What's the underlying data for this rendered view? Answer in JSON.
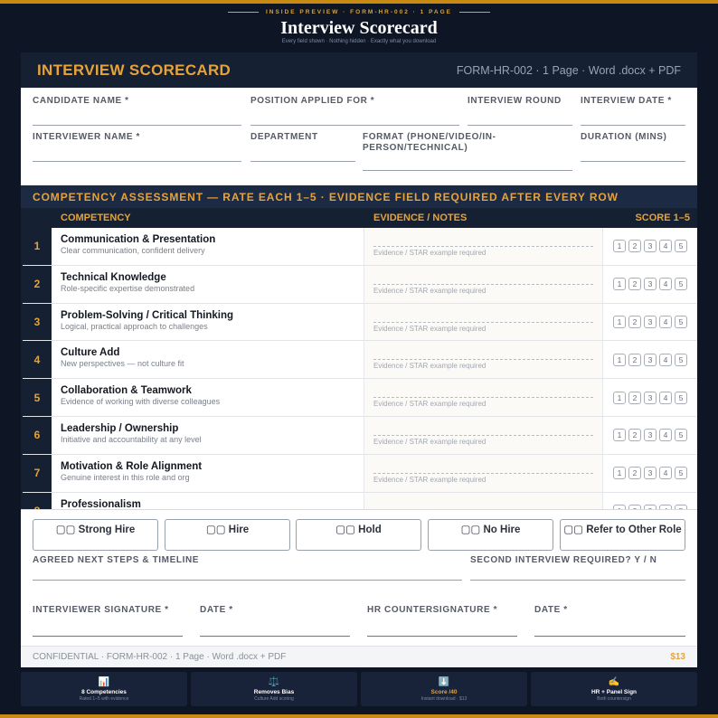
{
  "preview": {
    "kicker": "INSIDE PREVIEW · FORM-HR-002 · 1 PAGE",
    "title": "Interview Scorecard",
    "subtitle": "Every field shown · Nothing hidden · Exactly what you download"
  },
  "doc": {
    "title": "INTERVIEW SCORECARD",
    "meta": "FORM-HR-002 · 1 Page · Word .docx + PDF"
  },
  "fields": {
    "candidate_name": "CANDIDATE NAME *",
    "position": "POSITION APPLIED FOR *",
    "round": "INTERVIEW ROUND",
    "date": "INTERVIEW DATE *",
    "interviewer": "INTERVIEWER NAME *",
    "department": "DEPARTMENT",
    "format": "FORMAT (PHONE/VIDEO/IN-PERSON/TECHNICAL)",
    "duration": "DURATION (MINS)"
  },
  "competency": {
    "band": "COMPETENCY ASSESSMENT — RATE EACH 1–5 · EVIDENCE FIELD REQUIRED AFTER EVERY ROW",
    "headers": {
      "competency": "COMPETENCY",
      "evidence": "EVIDENCE / NOTES",
      "score": "SCORE 1–5"
    },
    "evidence_hint": "Evidence / STAR example required",
    "scores": [
      "1",
      "2",
      "3",
      "4",
      "5"
    ],
    "rows": [
      {
        "num": "1",
        "name": "Communication & Presentation",
        "desc": "Clear communication, confident delivery"
      },
      {
        "num": "2",
        "name": "Technical Knowledge",
        "desc": "Role-specific expertise demonstrated"
      },
      {
        "num": "3",
        "name": "Problem-Solving / Critical Thinking",
        "desc": "Logical, practical approach to challenges"
      },
      {
        "num": "4",
        "name": "Culture Add",
        "desc": "New perspectives — not culture fit"
      },
      {
        "num": "5",
        "name": "Collaboration & Teamwork",
        "desc": "Evidence of working with diverse colleagues"
      },
      {
        "num": "6",
        "name": "Leadership / Ownership",
        "desc": "Initiative and accountability at any level"
      },
      {
        "num": "7",
        "name": "Motivation & Role Alignment",
        "desc": "Genuine interest in this role and org"
      },
      {
        "num": "8",
        "name": "Professionalism",
        "desc": ""
      }
    ]
  },
  "recommendation": {
    "options": [
      "▢▢ Strong Hire",
      "▢▢ Hire",
      "▢▢ Hold",
      "▢▢ No Hire",
      "▢▢ Refer to Other Role"
    ]
  },
  "bottom": {
    "next_steps": "AGREED NEXT STEPS & TIMELINE",
    "second_interview": "SECOND INTERVIEW REQUIRED? Y / N",
    "signature": "INTERVIEWER SIGNATURE *",
    "date1": "DATE *",
    "hr_sign": "HR COUNTERSIGNATURE *",
    "date2": "DATE *"
  },
  "footer": {
    "left": "CONFIDENTIAL · FORM-HR-002 · 1 Page · Word .docx + PDF",
    "price": "$13"
  },
  "features": [
    {
      "icon": "📊",
      "icon_name": "bar-chart-icon",
      "title": "8 Competencies",
      "sub": "Rated 1–5 with evidence"
    },
    {
      "icon": "⚖️",
      "icon_name": "scales-icon",
      "title": "Removes Bias",
      "sub": "Culture Add scoring"
    },
    {
      "icon": "⬇️",
      "icon_name": "download-icon",
      "title": "Score /40",
      "sub": "Instant download · $13"
    },
    {
      "icon": "✍️",
      "icon_name": "signature-icon",
      "title": "HR + Panel Sign",
      "sub": "Both countersign"
    }
  ],
  "colors": {
    "navy": "#152033",
    "gold": "#e6a33a",
    "background": "#0e1626"
  }
}
